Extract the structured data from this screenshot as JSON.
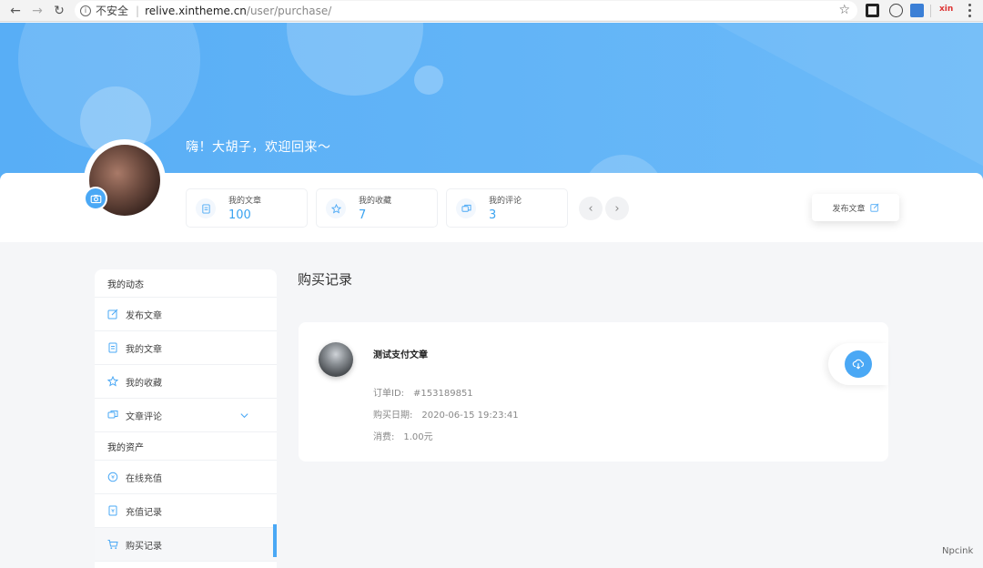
{
  "browser": {
    "insecure_label": "不安全",
    "url_domain": "relive.xintheme.cn",
    "url_path": "/user/purchase/",
    "ext_label": "xin"
  },
  "banner": {
    "greeting": "嗨！大胡子，欢迎回来～"
  },
  "stats": [
    {
      "label": "我的文章",
      "value": "100"
    },
    {
      "label": "我的收藏",
      "value": "7"
    },
    {
      "label": "我的评论",
      "value": "3"
    }
  ],
  "publish_button": "发布文章",
  "sidebar": {
    "section1": "我的动态",
    "items1": [
      "发布文章",
      "我的文章",
      "我的收藏",
      "文章评论"
    ],
    "section2": "我的资产",
    "items2": [
      "在线充值",
      "充值记录",
      "购买记录"
    ]
  },
  "main": {
    "title": "购买记录",
    "record": {
      "title": "测试支付文章",
      "order_label": "订单ID:",
      "order_value": "#153189851",
      "date_label": "购买日期:",
      "date_value": "2020-06-15 19:23:41",
      "cost_label": "消费:",
      "cost_value": "1.00元"
    }
  },
  "watermark": "Npcink",
  "colors": {
    "accent": "#4aa8f5",
    "banner": "#62b4f7"
  }
}
